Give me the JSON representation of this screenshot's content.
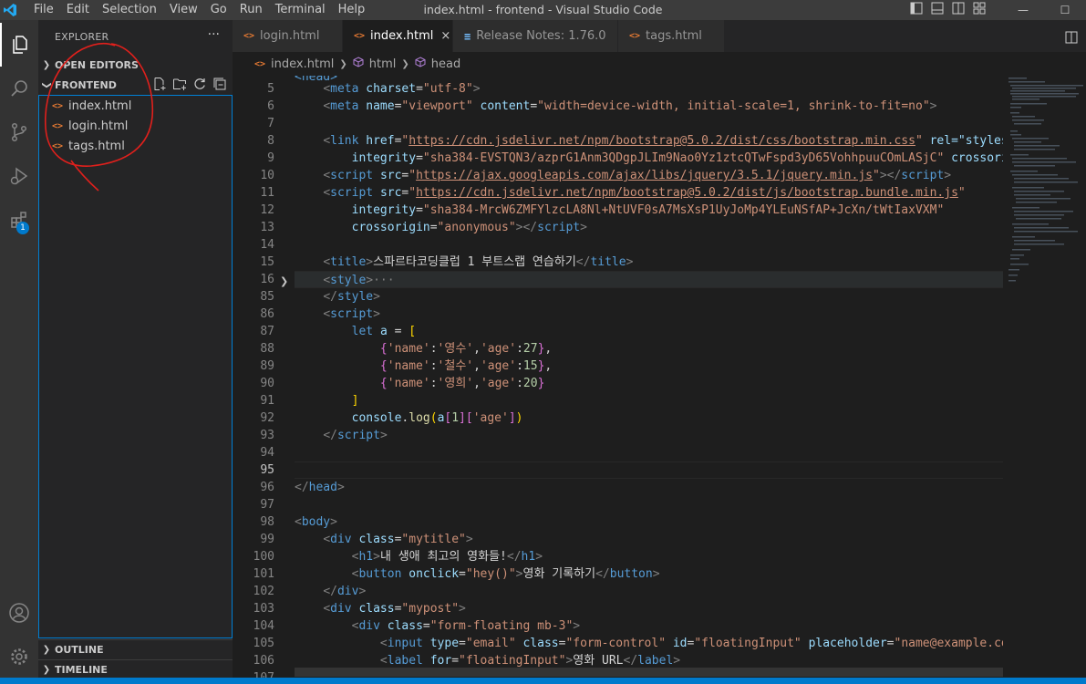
{
  "menu": [
    "File",
    "Edit",
    "Selection",
    "View",
    "Go",
    "Run",
    "Terminal",
    "Help"
  ],
  "window_title": "index.html - frontend - Visual Studio Code",
  "window_controls": {
    "minimize": "—",
    "maximize": "☐"
  },
  "activity": {
    "extensions_badge": "1"
  },
  "sidebar": {
    "title": "EXPLORER",
    "more": "···",
    "open_editors": "OPEN EDITORS",
    "folder": "FRONTEND",
    "files": [
      "index.html",
      "login.html",
      "tags.html"
    ],
    "outline": "OUTLINE",
    "timeline": "TIMELINE"
  },
  "tabs": [
    {
      "label": "login.html",
      "icon": "html-icon"
    },
    {
      "label": "index.html",
      "icon": "html-icon",
      "active": true,
      "close": "×"
    },
    {
      "label": "Release Notes: 1.76.0",
      "icon": "doc-icon"
    },
    {
      "label": "tags.html",
      "icon": "html-icon"
    }
  ],
  "breadcrumb": [
    "index.html",
    "html",
    "head"
  ],
  "line_numbers": [
    "5",
    "6",
    "7",
    "8",
    "9",
    "10",
    "11",
    "12",
    "13",
    "14",
    "15",
    "16",
    "85",
    "86",
    "87",
    "88",
    "89",
    "90",
    "91",
    "92",
    "93",
    "94",
    "95",
    "96",
    "97",
    "98",
    "99",
    "100",
    "101",
    "102",
    "103",
    "104",
    "105",
    "106",
    "107"
  ],
  "code": {
    "l5_meta_charset": "utf-8",
    "l6_viewport": "width=device-width, initial-scale=1, shrink-to-fit=no",
    "l8_href": "https://cdn.jsdelivr.net/npm/bootstrap@5.0.2/dist/css/bootstrap.min.css",
    "l8_rest": " rel=\"styleshe",
    "l9_integrity": "sha384-EVSTQN3/azprG1Anm3QDgpJLIm9Nao0Yz1ztcQTwFspd3yD65VohhpuuCOmLASjC",
    "l9_rest": " crossorig",
    "l10_src": "https://ajax.googleapis.com/ajax/libs/jquery/3.5.1/jquery.min.js",
    "l11_src": "https://cdn.jsdelivr.net/npm/bootstrap@5.0.2/dist/js/bootstrap.bundle.min.js",
    "l12_integrity": "sha384-MrcW6ZMFYlzcLA8Nl+NtUVF0sA7MsXsP1UyJoMp4YLEuNSfAP+JcXn/tWtIaxVXM",
    "l13_crossorigin": "anonymous",
    "l15_title": "스파르타코딩클럽 1 부트스랩 연습하기",
    "l16_fold": "···",
    "l88": {
      "name": "'영수'",
      "age": "27"
    },
    "l89": {
      "name": "'철수'",
      "age": "15"
    },
    "l90": {
      "name": "'영희'",
      "age": "20"
    },
    "l100_h1": "내 생애 최고의 영화들!",
    "l101_onclick": "hey()",
    "l101_text": "영화 기록하기",
    "l99_class": "mytitle",
    "l103_class": "mypost",
    "l104_class": "form-floating mb-3",
    "l105_type": "email",
    "l105_class": "form-control",
    "l105_id": "floatingInput",
    "l105_placeholder": "name@example.com",
    "l106_for": "floatingInput",
    "l106_text": "영화 URL"
  },
  "colors": {
    "accent": "#007acc",
    "annotation": "#e0201c"
  }
}
